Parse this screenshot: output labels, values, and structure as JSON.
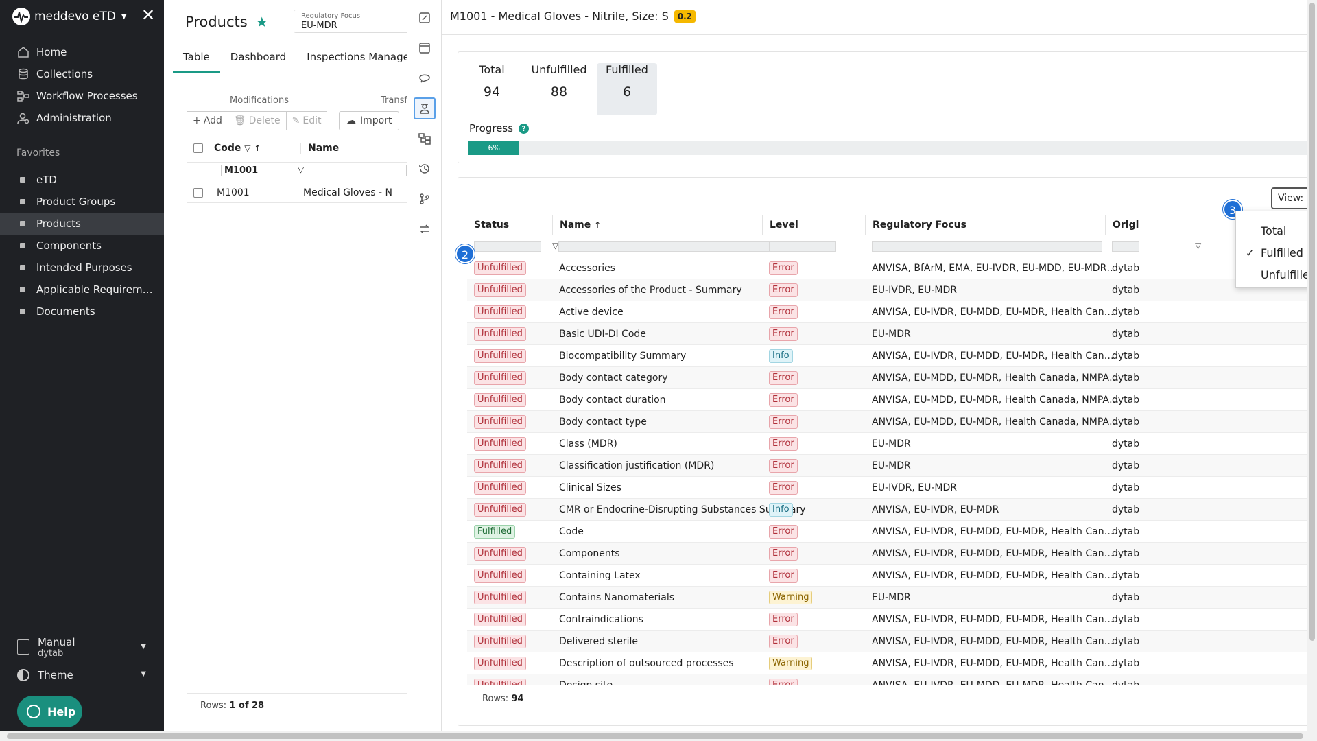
{
  "app": {
    "name": "meddevo eTD"
  },
  "sidebar": {
    "nav": [
      {
        "label": "Home",
        "icon": "home-icon"
      },
      {
        "label": "Collections",
        "icon": "database-icon"
      },
      {
        "label": "Workflow Processes",
        "icon": "workflow-icon"
      },
      {
        "label": "Administration",
        "icon": "user-cog-icon"
      }
    ],
    "favorites_title": "Favorites",
    "favorites": [
      {
        "label": "eTD"
      },
      {
        "label": "Product Groups"
      },
      {
        "label": "Products",
        "active": true
      },
      {
        "label": "Components"
      },
      {
        "label": "Intended Purposes"
      },
      {
        "label": "Applicable Requirem…"
      },
      {
        "label": "Documents"
      }
    ],
    "manual": {
      "title": "Manual",
      "subtitle": "dytab"
    },
    "theme": "Theme",
    "help": "Help"
  },
  "products": {
    "title": "Products",
    "regulatory_focus": {
      "label": "Regulatory Focus",
      "value": "EU-MDR"
    },
    "tabs": [
      "Table",
      "Dashboard",
      "Inspections Managem"
    ],
    "modifications_label": "Modifications",
    "transfer_label": "Transf",
    "toolbar": {
      "add": "Add",
      "delete": "Delete",
      "edit": "Edit",
      "import": "Import"
    },
    "columns": {
      "code": "Code",
      "name": "Name"
    },
    "filter_code": "M1001",
    "row": {
      "code": "M1001",
      "name": "Medical Gloves - N"
    },
    "footer": {
      "label": "Rows:",
      "value": "1 of 28"
    }
  },
  "panel": {
    "title": "M1001 - Medical Gloves - Nitrile, Size: S",
    "version": "0.2",
    "stats": [
      {
        "label": "Total",
        "value": "94"
      },
      {
        "label": "Unfulfilled",
        "value": "88"
      },
      {
        "label": "Fulfilled",
        "value": "6",
        "selected": true
      }
    ],
    "progress": {
      "label": "Progress",
      "percent": 6,
      "text": "6%"
    },
    "view_button": "View: Fulf",
    "columns": {
      "status": "Status",
      "name": "Name",
      "level": "Level",
      "regulatory_focus": "Regulatory Focus",
      "origin": "Origi"
    },
    "rows": [
      {
        "status": "Unfulfilled",
        "name": "Accessories",
        "level": "Error",
        "focus": "ANVISA, BfArM, EMA, EU-IVDR, EU-MDD, EU-MDR, Health ...",
        "origin": "dytab"
      },
      {
        "status": "Unfulfilled",
        "name": "Accessories of the Product - Summary",
        "level": "Error",
        "focus": "EU-IVDR, EU-MDR",
        "origin": "dytab"
      },
      {
        "status": "Unfulfilled",
        "name": "Active device",
        "level": "Error",
        "focus": "ANVISA, EU-IVDR, EU-MDD, EU-MDR, Health Canada, NM...",
        "origin": "dytab"
      },
      {
        "status": "Unfulfilled",
        "name": "Basic UDI-DI Code",
        "level": "Error",
        "focus": "EU-MDR",
        "origin": "dytab"
      },
      {
        "status": "Unfulfilled",
        "name": "Biocompatibility Summary",
        "level": "Info",
        "focus": "ANVISA, EU-IVDR, EU-MDD, EU-MDR, Health Canada, NM...",
        "origin": "dytab"
      },
      {
        "status": "Unfulfilled",
        "name": "Body contact category",
        "level": "Error",
        "focus": "ANVISA, EU-MDD, EU-MDR, Health Canada, NMPA, PMDA...",
        "origin": "dytab"
      },
      {
        "status": "Unfulfilled",
        "name": "Body contact duration",
        "level": "Error",
        "focus": "ANVISA, EU-MDD, EU-MDR, Health Canada, NMPA, PMDA...",
        "origin": "dytab"
      },
      {
        "status": "Unfulfilled",
        "name": "Body contact type",
        "level": "Error",
        "focus": "ANVISA, EU-MDD, EU-MDR, Health Canada, NMPA, PMDA...",
        "origin": "dytab"
      },
      {
        "status": "Unfulfilled",
        "name": "Class (MDR)",
        "level": "Error",
        "focus": "EU-MDR",
        "origin": "dytab"
      },
      {
        "status": "Unfulfilled",
        "name": "Classification justification (MDR)",
        "level": "Error",
        "focus": "EU-MDR",
        "origin": "dytab"
      },
      {
        "status": "Unfulfilled",
        "name": "Clinical Sizes",
        "level": "Error",
        "focus": "EU-IVDR, EU-MDR",
        "origin": "dytab"
      },
      {
        "status": "Unfulfilled",
        "name": "CMR or Endocrine-Disrupting Substances Summary",
        "level": "Info",
        "focus": "ANVISA, EU-IVDR, EU-MDR",
        "origin": "dytab"
      },
      {
        "status": "Fulfilled",
        "name": "Code",
        "level": "Error",
        "focus": "ANVISA, EU-IVDR, EU-MDD, EU-MDR, Health Canada, NM...",
        "origin": "dytab"
      },
      {
        "status": "Unfulfilled",
        "name": "Components",
        "level": "Error",
        "focus": "ANVISA, EU-IVDR, EU-MDD, EU-MDR, Health Canada, NMPA, PMDA...",
        "origin": "dytab"
      },
      {
        "status": "Unfulfilled",
        "name": "Containing Latex",
        "level": "Error",
        "focus": "ANVISA, EU-IVDR, EU-MDD, EU-MDR, Health Canada, NM...",
        "origin": "dytab"
      },
      {
        "status": "Unfulfilled",
        "name": "Contains Nanomaterials",
        "level": "Warning",
        "focus": "EU-MDR",
        "origin": "dytab"
      },
      {
        "status": "Unfulfilled",
        "name": "Contraindications",
        "level": "Error",
        "focus": "ANVISA, EU-IVDR, EU-MDD, EU-MDR, Health Canada, NM...",
        "origin": "dytab"
      },
      {
        "status": "Unfulfilled",
        "name": "Delivered sterile",
        "level": "Error",
        "focus": "ANVISA, EU-IVDR, EU-MDD, EU-MDR, Health Canada, NM...",
        "origin": "dytab"
      },
      {
        "status": "Unfulfilled",
        "name": "Description of outsourced processes",
        "level": "Warning",
        "focus": "ANVISA, EU-IVDR, EU-MDD, EU-MDR, Health Canada, NM...",
        "origin": "dytab"
      },
      {
        "status": "Unfulfilled",
        "name": "Design site",
        "level": "Error",
        "focus": "ANVISA, EU-IVDR, EU-MDD, EU-MDR, Health Canada, NM...",
        "origin": "dytab"
      }
    ],
    "footer": {
      "label": "Rows:",
      "value": "94"
    },
    "view_menu": [
      {
        "label": "Total",
        "checked": false
      },
      {
        "label": "Fulfilled",
        "checked": true
      },
      {
        "label": "Unfulfille",
        "checked": false
      }
    ],
    "markers": [
      "2",
      "3"
    ]
  },
  "colors": {
    "accent": "#1a9a86",
    "sidebar": "#1f2125",
    "marker": "#1f6fd6",
    "version_badge": "#f5b800"
  }
}
